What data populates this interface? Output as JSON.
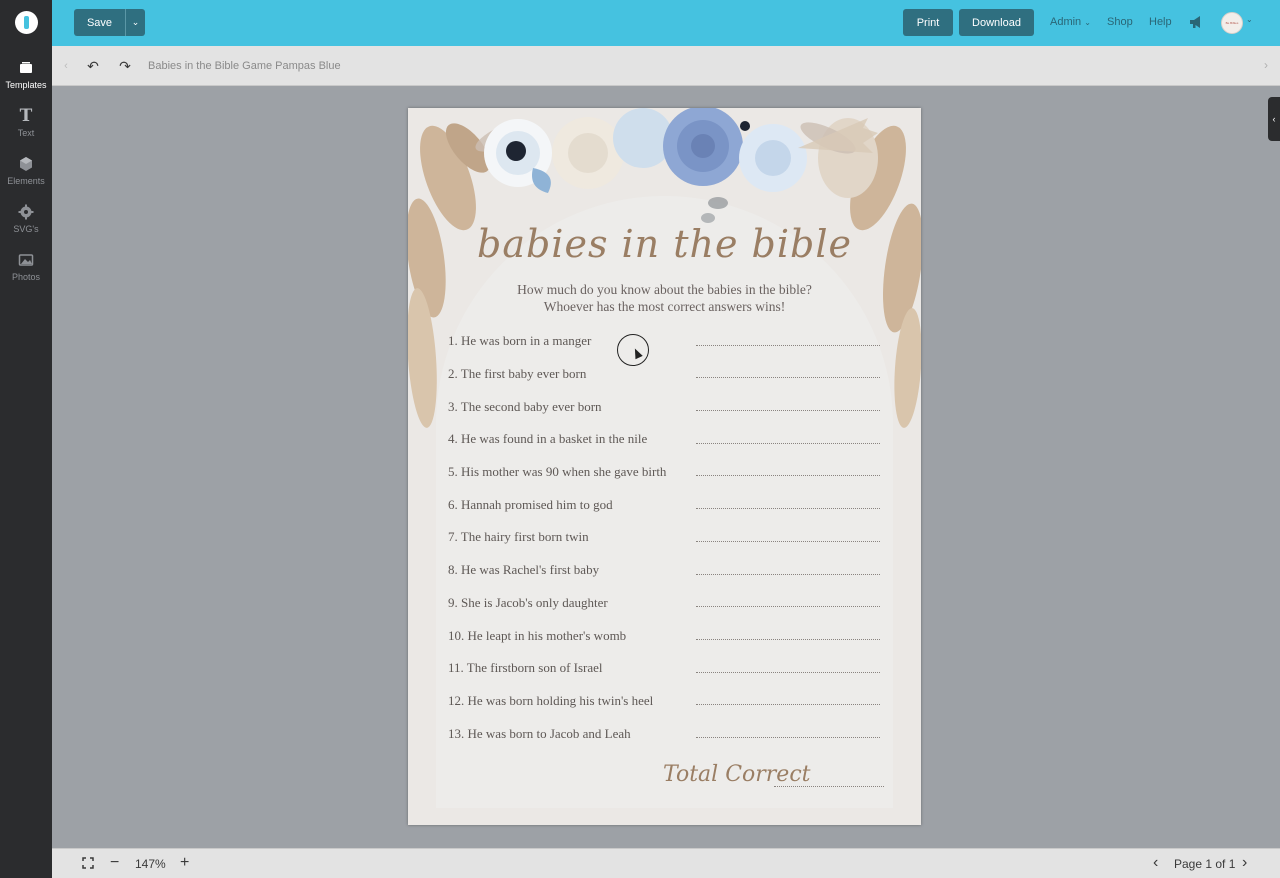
{
  "sidebar": {
    "items": [
      {
        "label": "Templates",
        "icon": "templates-icon"
      },
      {
        "label": "Text",
        "icon": "text-icon"
      },
      {
        "label": "Elements",
        "icon": "cube-icon"
      },
      {
        "label": "SVG's",
        "icon": "gear-icon"
      },
      {
        "label": "Photos",
        "icon": "image-icon"
      }
    ]
  },
  "topbar": {
    "save_label": "Save",
    "print_label": "Print",
    "download_label": "Download",
    "admin_label": "Admin",
    "shop_label": "Shop",
    "help_label": "Help",
    "avatar_text": "Be Bibles"
  },
  "toolbar": {
    "doc_title": "Babies in the Bible Game Pampas Blue"
  },
  "document": {
    "title": "babies in the bible",
    "intro_line1": "How much do you know about the babies in the bible?",
    "intro_line2": "Whoever has the most correct answers wins!",
    "questions": [
      "1. He was born in a manger",
      "2. The first baby ever born",
      "3. The second baby ever born",
      "4. He was found in a basket in the nile",
      "5. His mother was 90 when she gave birth",
      "6. Hannah promised him to god",
      "7. The hairy first born twin",
      "8. He was Rachel's first baby",
      "9. She is Jacob's only daughter",
      "10. He leapt in his mother's womb",
      "11. The firstborn son of Israel",
      "12. He was born holding his twin's heel",
      "13. He was born to Jacob and Leah"
    ],
    "total_label": "Total Correct"
  },
  "bottombar": {
    "zoom": "147%",
    "page_indicator": "Page 1 of 1"
  },
  "colors": {
    "topbar": "#45c2e0",
    "button": "#2f6f80",
    "sidebar": "#2b2c2e",
    "title_brown": "#9a7e64"
  }
}
